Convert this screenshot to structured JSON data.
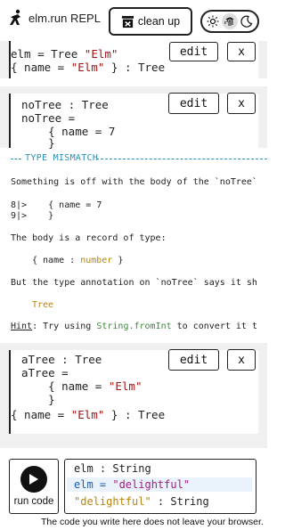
{
  "header": {
    "title": "elm.run REPL",
    "cleanup_label": "clean up",
    "theme_icons": [
      "sun-icon",
      "fingerprint-icon",
      "moon-icon"
    ]
  },
  "block1": {
    "lines": [
      "elm = Tree \"Elm\"",
      "{ name = \"Elm\" } : Tree"
    ],
    "edit_label": "edit",
    "close_label": "x"
  },
  "block2": {
    "lines": [
      "noTree : Tree",
      "noTree =",
      "    { name = 7",
      "    }"
    ],
    "edit_label": "edit",
    "close_label": "x"
  },
  "error": {
    "title": "TYPE MISMATCH",
    "message1": "Something is off with the body of the `noTree`",
    "gutter1": "8|>",
    "code1": "    { name = 7",
    "gutter2": "9|>",
    "code2": "    }",
    "message2": "The body is a record of type:",
    "record_type_prefix": "{ name : ",
    "record_type_num": "number",
    "record_type_suffix": " }",
    "message3": "But the type annotation on `noTree` says it sh",
    "expected_type": "Tree",
    "hint_label": "Hint",
    "hint_text": ": Try using ",
    "hint_fn": "String.fromInt",
    "hint_rest": " to convert it t"
  },
  "block3": {
    "lines": [
      "aTree : Tree",
      "aTree =",
      "    { name = \"Elm\"",
      "    }"
    ],
    "result": "{ name = \"Elm\" } : Tree",
    "edit_label": "edit",
    "close_label": "x"
  },
  "input": {
    "run_label": "run code",
    "line1": "elm : String",
    "line2_prefix": "elm = ",
    "line2_str": "\"delightful\"",
    "line3_str": "\"delightful\"",
    "line3_suffix": " : String"
  },
  "footer": {
    "note": "The code you write here does not leave your browser."
  }
}
